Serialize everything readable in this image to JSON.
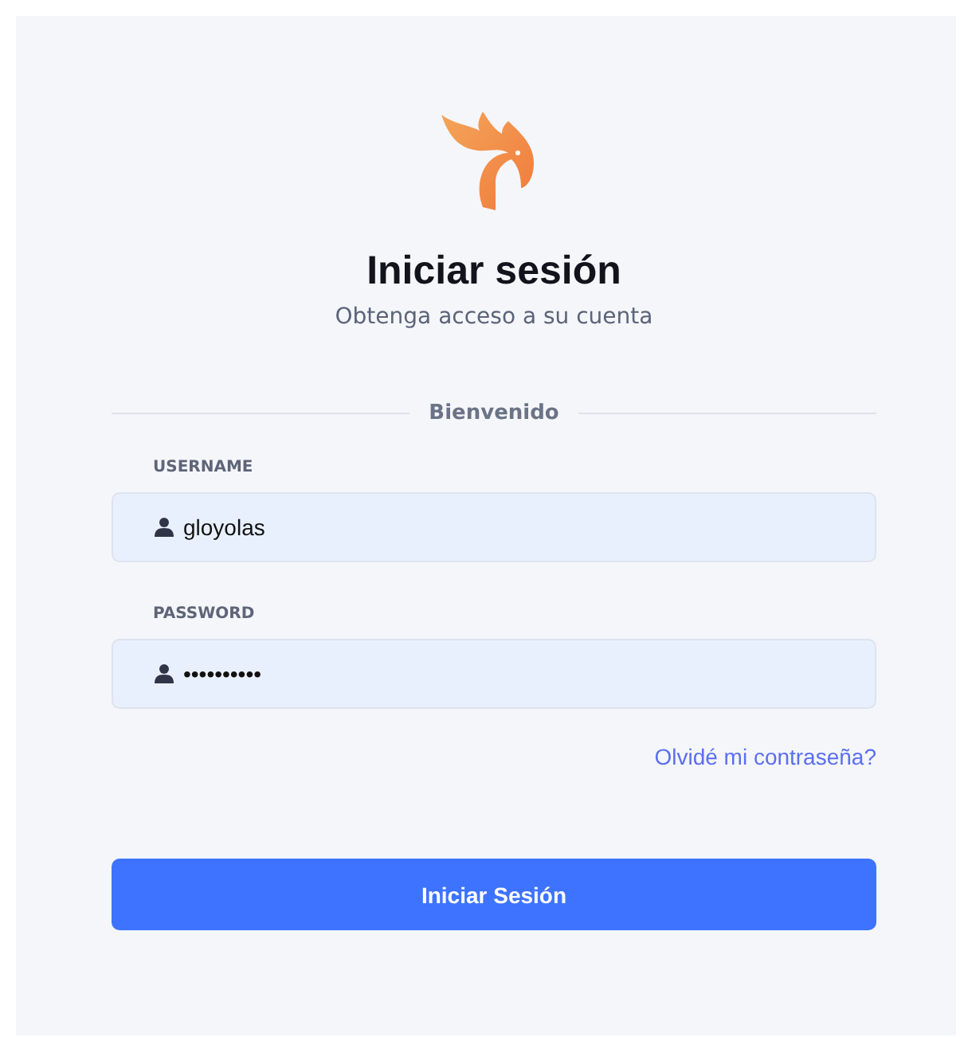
{
  "title": "Iniciar sesión",
  "subtitle": "Obtenga acceso a su cuenta",
  "divider_label": "Bienvenido",
  "fields": [
    {
      "label": "USERNAME",
      "value": "gloyolas"
    },
    {
      "label": "PASSWORD",
      "value": "••••••••••"
    }
  ],
  "forgot_link": "Olvidé mi contraseña?",
  "submit_button": "Iniciar Sesión"
}
